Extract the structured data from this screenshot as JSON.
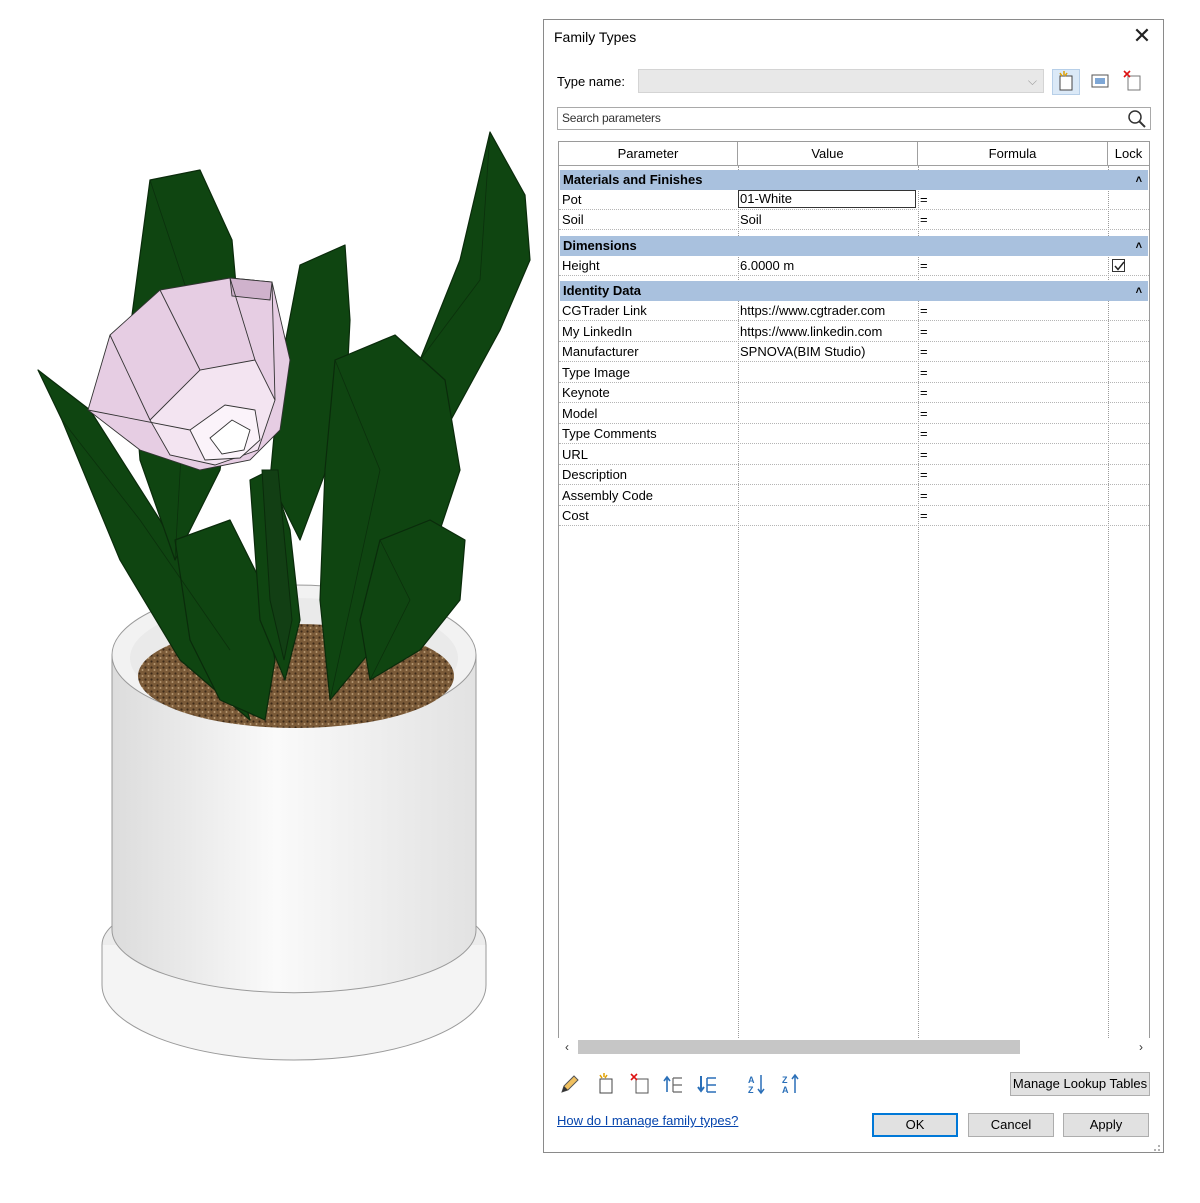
{
  "dialog": {
    "title": "Family Types",
    "type_name_label": "Type name:",
    "type_name_value": "",
    "search_placeholder": "Search parameters",
    "columns": [
      "Parameter",
      "Value",
      "Formula",
      "Lock"
    ],
    "groups": [
      {
        "name": "Materials and Finishes",
        "rows": [
          {
            "parameter": "Pot",
            "value": "01-White",
            "formula": "=",
            "lock": false
          },
          {
            "parameter": "Soil",
            "value": "Soil",
            "formula": "=",
            "lock": false
          }
        ]
      },
      {
        "name": "Dimensions",
        "rows": [
          {
            "parameter": "Height",
            "value": "6.0000 m",
            "formula": "=",
            "lock": true
          }
        ]
      },
      {
        "name": "Identity Data",
        "rows": [
          {
            "parameter": "CGTrader Link",
            "value": "https://www.cgtrader.com",
            "formula": "=",
            "lock": false
          },
          {
            "parameter": "My LinkedIn",
            "value": "https://www.linkedin.com",
            "formula": "=",
            "lock": false
          },
          {
            "parameter": "Manufacturer",
            "value": "SPNOVA(BIM Studio)",
            "formula": "=",
            "lock": false
          },
          {
            "parameter": "Type Image",
            "value": "",
            "formula": "=",
            "lock": false
          },
          {
            "parameter": "Keynote",
            "value": "",
            "formula": "=",
            "lock": false
          },
          {
            "parameter": "Model",
            "value": "",
            "formula": "=",
            "lock": false
          },
          {
            "parameter": "Type Comments",
            "value": "",
            "formula": "=",
            "lock": false
          },
          {
            "parameter": "URL",
            "value": "",
            "formula": "=",
            "lock": false
          },
          {
            "parameter": "Description",
            "value": "",
            "formula": "=",
            "lock": false
          },
          {
            "parameter": "Assembly Code",
            "value": "",
            "formula": "=",
            "lock": false
          },
          {
            "parameter": "Cost",
            "value": "",
            "formula": "=",
            "lock": false
          }
        ]
      }
    ],
    "collapse_glyph": "˄",
    "manage_lookup_label": "Manage Lookup Tables",
    "help_link": "How do I manage family types?",
    "ok_label": "OK",
    "cancel_label": "Cancel",
    "apply_label": "Apply",
    "scroll_left": "‹",
    "scroll_right": "›",
    "icons": [
      "pencil-icon",
      "new-parameter-icon",
      "delete-parameter-icon",
      "move-up-icon",
      "move-down-icon",
      "sort-ascending-icon",
      "sort-descending-icon"
    ],
    "accent": "#0078d7",
    "group_header_color": "#a9c1de"
  },
  "model_colors": {
    "leaf": "#0f4511",
    "flower": "#e6cde3",
    "pot": "#f0f0f0",
    "soil": "#6b5133"
  }
}
